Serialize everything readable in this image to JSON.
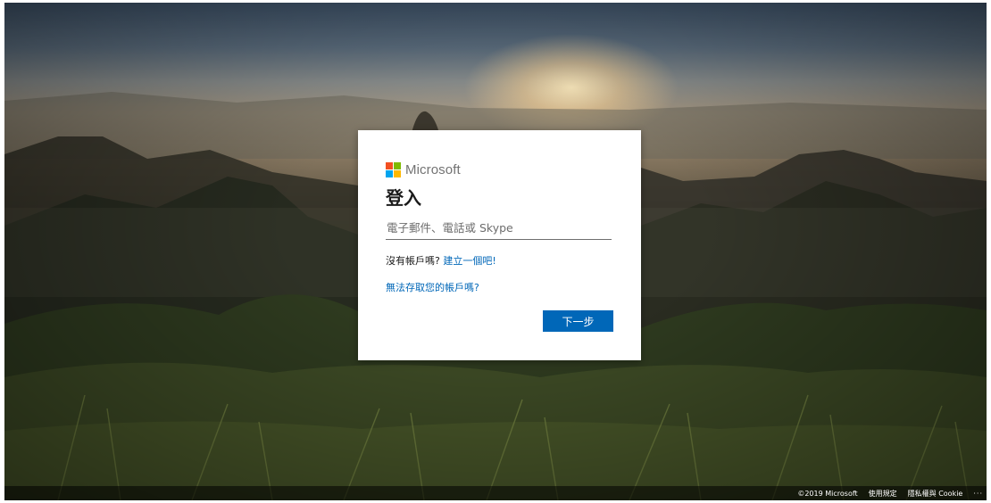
{
  "card": {
    "brand": "Microsoft",
    "title": "登入",
    "account_input": {
      "value": "",
      "placeholder": "電子郵件、電話或 Skype"
    },
    "no_account_text": "沒有帳戶嗎?",
    "create_link": "建立一個吧!",
    "cant_access_link": "無法存取您的帳戶嗎?",
    "next_button": "下一步"
  },
  "footer": {
    "copyright": "©2019 Microsoft",
    "terms": "使用規定",
    "privacy": "隱私權與 Cookie",
    "more": "···"
  },
  "colors": {
    "accent": "#0067b8",
    "logo_red": "#f25022",
    "logo_green": "#7fba00",
    "logo_blue": "#00a4ef",
    "logo_yellow": "#ffb900"
  },
  "icons": [
    "microsoft-logo-icon",
    "more-options-icon"
  ]
}
